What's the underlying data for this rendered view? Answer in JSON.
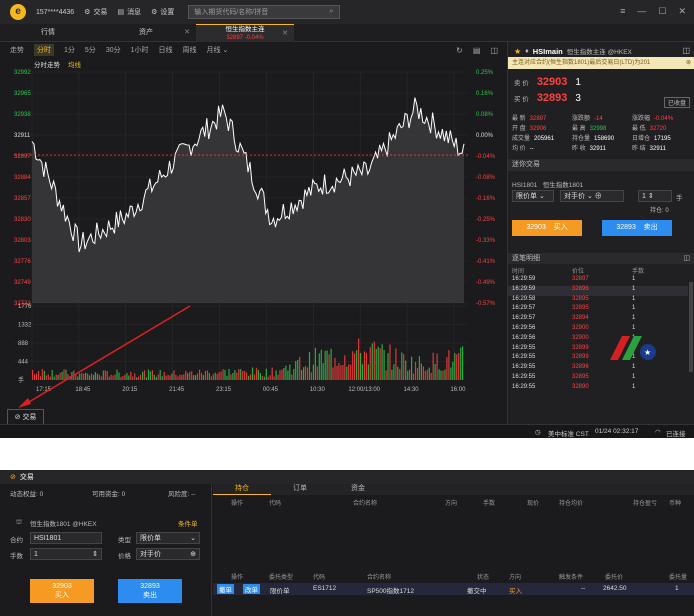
{
  "top": {
    "account": "157****4436",
    "menu": [
      "交易",
      "消息",
      "设置"
    ],
    "search_placeholder": "输入期货代码/名称/拼音"
  },
  "tabs": [
    {
      "label": "行情"
    },
    {
      "label": "资产"
    },
    {
      "label": "恒生指数主连",
      "sub_price": "32897",
      "sub_change": "-0.04%"
    }
  ],
  "periods": [
    "走势",
    "分时",
    "1分",
    "5分",
    "30分",
    "1小时",
    "日线",
    "周线",
    "月线"
  ],
  "chart": {
    "legend_title": "分时走势",
    "legend_avg": "均线",
    "price_labels": [
      "32992",
      "32965",
      "32938",
      "32911",
      "32897",
      "32884",
      "32857",
      "32830",
      "32803",
      "32776",
      "32749",
      "32722"
    ],
    "pct_labels": [
      "0.25%",
      "0.16%",
      "0.08%",
      "0.00%",
      "-0.04%",
      "-0.08%",
      "-0.16%",
      "-0.25%",
      "-0.33%",
      "-0.41%",
      "-0.49%",
      "-0.57%"
    ],
    "vol_labels": [
      "1776",
      "1332",
      "888",
      "444",
      "手"
    ],
    "time_labels": [
      "17:15",
      "18:45",
      "20:15",
      "21:45",
      "23:15",
      "00:45",
      "10:30",
      "12:00/13:00",
      "14:30",
      "16:00"
    ]
  },
  "chart_data": {
    "type": "line",
    "title": "",
    "xlabel": "",
    "ylabel": "",
    "ylim": [
      32722,
      32992
    ],
    "x": [
      "17:15",
      "18:45",
      "20:15",
      "21:45",
      "23:15",
      "00:45",
      "10:30",
      "12:00/13:00",
      "14:30",
      "16:00"
    ],
    "series": [
      {
        "values": [
          32911,
          32790,
          32825,
          32890,
          32945,
          32820,
          32860,
          32875,
          32950,
          32897
        ]
      }
    ],
    "volume": {
      "ylim": [
        0,
        1776
      ],
      "values": [
        300,
        180,
        220,
        200,
        260,
        250,
        700,
        900,
        500,
        700
      ]
    }
  },
  "trade_button": "交易",
  "status": {
    "timezone": "美中标准 CST",
    "datetime": "01/24 02:32:17",
    "conn": "已连接"
  },
  "right": {
    "symbol": "HSImain",
    "symbol_name": "恒生指数主连 @HKEX",
    "notice": "主连对应合约(恒生指数1801)最后交易日(LTD)为201",
    "sell_label": "卖 价",
    "sell_price": "32903",
    "sell_qty": "1",
    "buy_label": "买 价",
    "buy_price": "32893",
    "buy_qty": "3",
    "closed": "已收盘",
    "stats": [
      [
        [
          "最  新",
          "32897",
          "red"
        ],
        [
          "涨跌额",
          "-14",
          "red"
        ],
        [
          "涨跌幅",
          "-0.04%",
          "red"
        ]
      ],
      [
        [
          "开  盘",
          "32906",
          "red"
        ],
        [
          "最  高",
          "32998",
          "green"
        ],
        [
          "最  低",
          "32720",
          "red"
        ]
      ],
      [
        [
          "成交量",
          "205961",
          "wht"
        ],
        [
          "持仓量",
          "158690",
          "wht"
        ],
        [
          "日增仓",
          "17195",
          "wht"
        ]
      ],
      [
        [
          "均  价",
          "--",
          "wht"
        ],
        [
          "昨  收",
          "32911",
          "wht"
        ],
        [
          "昨  结",
          "32911",
          "wht"
        ]
      ]
    ],
    "quick_title": "迷你交易",
    "contract": "HSI1801",
    "contract_name": "恒生指数1801",
    "order_type": "限价单",
    "price_type": "对手价",
    "qty": "1",
    "qty_unit": "手",
    "position": "持仓: 0",
    "buy_btn_price": "32903",
    "buy_btn": "买入",
    "sell_btn_price": "32893",
    "sell_btn": "卖出",
    "ticks_title": "逐笔明细",
    "ticks_headers": [
      "时间",
      "价位",
      "手数"
    ],
    "ticks": [
      [
        "16:29:59",
        "32897",
        "1"
      ],
      [
        "16:29:59",
        "32896",
        "1"
      ],
      [
        "16:29:58",
        "32895",
        "1"
      ],
      [
        "16:29:57",
        "32895",
        "1"
      ],
      [
        "16:29:57",
        "32894",
        "1"
      ],
      [
        "16:29:56",
        "32900",
        "1"
      ],
      [
        "16:29:56",
        "32900",
        "1"
      ],
      [
        "16:29:55",
        "32899",
        "1"
      ],
      [
        "16:29:55",
        "32899",
        "1"
      ],
      [
        "16:29:55",
        "32896",
        "1"
      ],
      [
        "16:29:55",
        "32895",
        "1"
      ],
      [
        "16:29:55",
        "32890",
        "1"
      ]
    ]
  },
  "panel2": {
    "title": "交易",
    "equity": "动态权益: 0",
    "available": "可用资金: 0",
    "risk": "风险度: --",
    "contract_title": "恒生指数1801 @HKEX",
    "cond": "条件单",
    "contract_label": "合约",
    "contract_value": "HSI1801",
    "type_label": "类型",
    "type_value": "限价单",
    "qty_label": "手数",
    "qty_value": "1",
    "price_label": "价格",
    "price_value": "对手价",
    "buy_price": "32903",
    "buy": "买入",
    "sell_price": "32893",
    "sell": "卖出",
    "tabs": [
      "持仓",
      "订单",
      "资金"
    ],
    "pos_headers": [
      "操作",
      "代码",
      "合约名称",
      "方向",
      "手数",
      "现价",
      "持仓均价",
      "持仓盈亏",
      "币种"
    ],
    "order_headers": [
      "操作",
      "委托类型",
      "代码",
      "合约名称",
      "状态",
      "方向",
      "触发条件",
      "委托价",
      "委托量"
    ],
    "order_row": {
      "btn1": "撤单",
      "btn2": "改单",
      "type": "限价单",
      "code": "ES1712",
      "name": "SP500指数1712",
      "status": "撤交中",
      "dir": "买入",
      "trigger": "--",
      "price": "2642.50",
      "qty": "1"
    }
  }
}
